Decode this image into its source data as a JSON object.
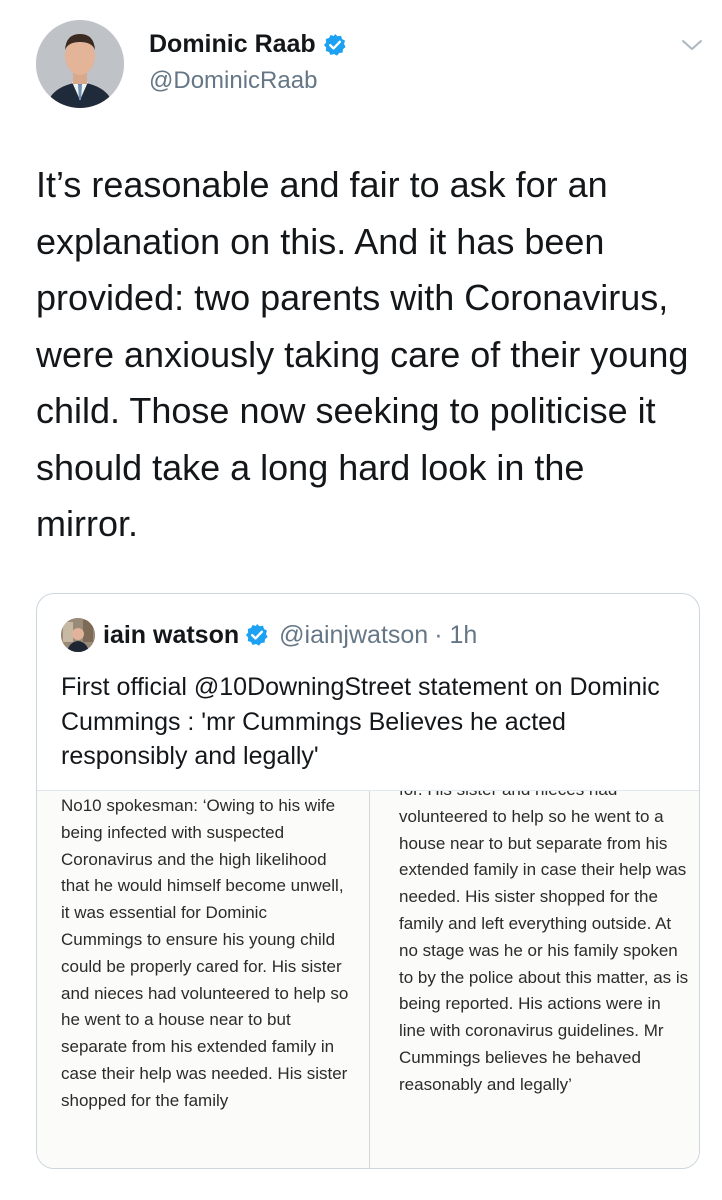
{
  "author": {
    "display_name": "Dominic Raab",
    "handle": "@DominicRaab",
    "verified": true,
    "avatar_icon": "profile-photo"
  },
  "tweet": {
    "text": "It’s reasonable and fair to ask for an explanation on this. And it has been provided: two parents with Coronavirus, were anxiously taking care of their young child. Those now seeking to politicise it should take a long hard look in the mirror."
  },
  "quoted_tweet": {
    "display_name": "iain watson",
    "handle": "@iainjwatson",
    "time": "· 1h",
    "verified": true,
    "text": "First official @10DowningStreet statement on Dominic Cummings : 'mr Cummings Believes he acted responsibly and legally'",
    "image": {
      "left_column": "No10 spokesman: ‘Owing to his wife being infected with suspected Coronavirus and the high likelihood that he would himself become unwell, it was essential for Dominic Cummings to ensure his young child could be properly cared for. His sister and nieces had volunteered to help so he went to a house near to but separate from his extended family in case their help was needed. His sister shopped for the family",
      "right_column": "for. His sister and nieces had volunteered to help so he went to a house near to but separate from his extended family in case their help was needed. His sister shopped for the family and left everything outside. At no stage was he or his family spoken to by the police about this matter, as is being reported. His actions were in line with coronavirus guidelines. Mr Cummings believes he behaved reasonably and legally’"
    }
  },
  "colors": {
    "verified_blue": "#1da1f2",
    "secondary_text": "#657786",
    "border": "#ccd6dd"
  }
}
